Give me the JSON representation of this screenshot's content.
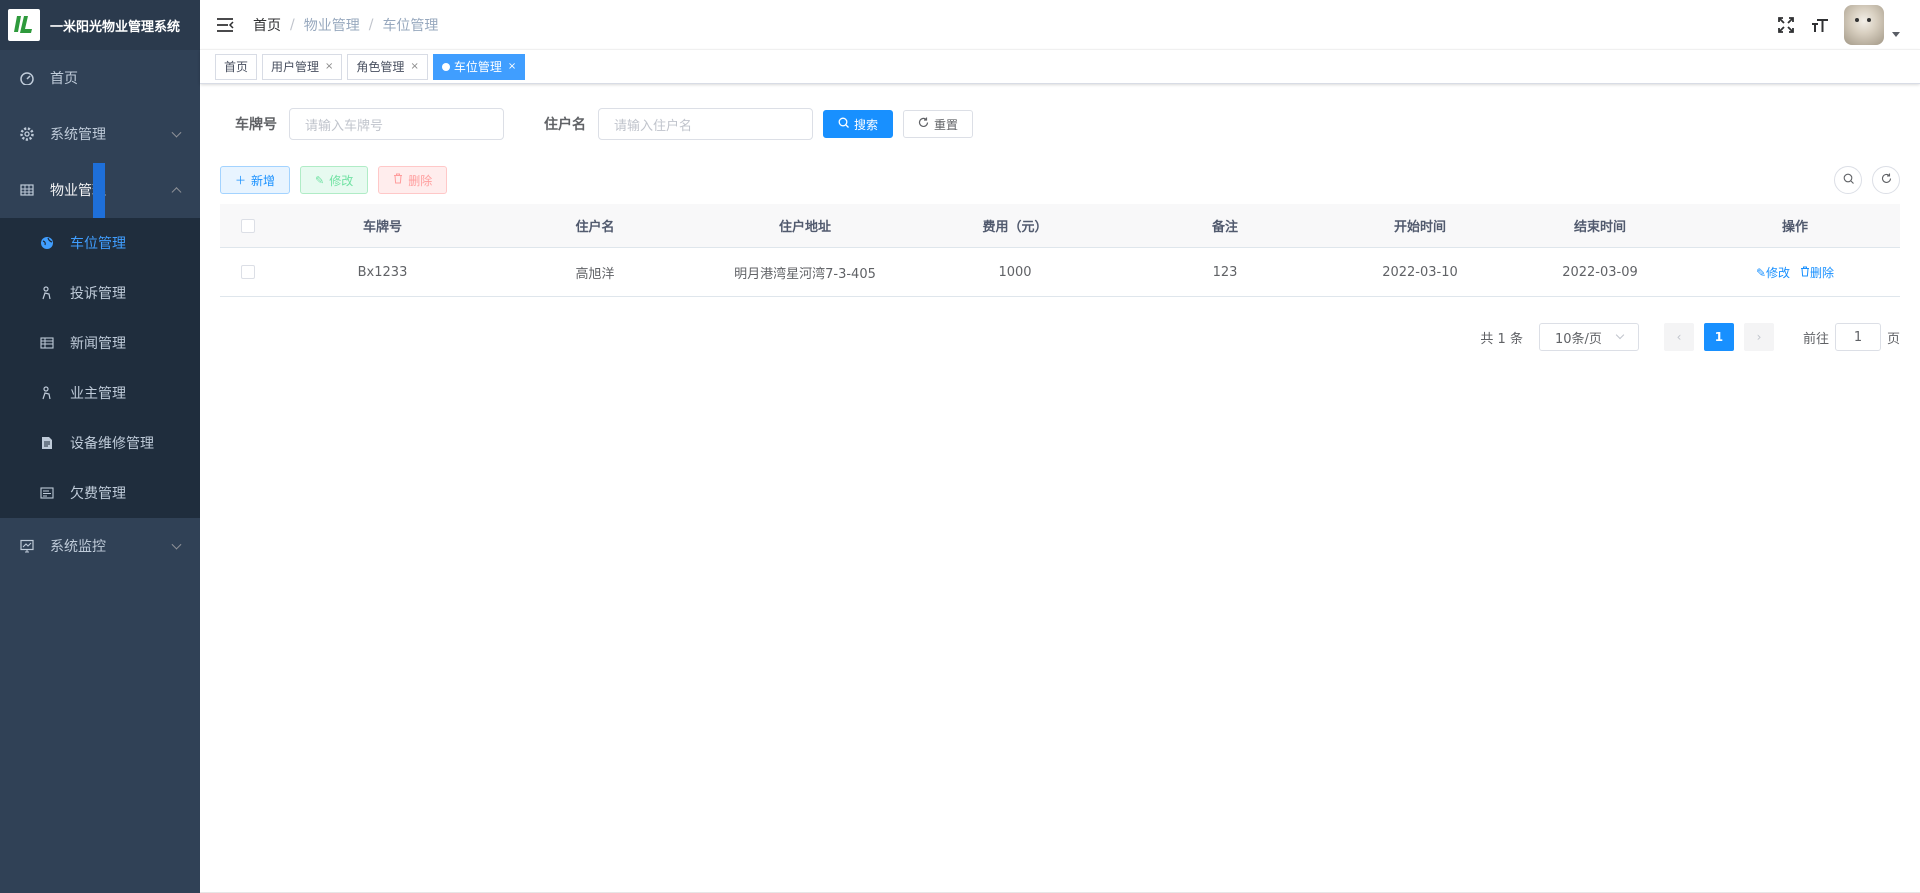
{
  "app": {
    "title": "一米阳光物业管理系统",
    "logo_text": "IL"
  },
  "sidebar": {
    "items": [
      {
        "label": "首页",
        "icon": "dashboard-icon"
      },
      {
        "label": "系统管理",
        "icon": "gear-icon"
      },
      {
        "label": "物业管理",
        "icon": "grid-icon"
      },
      {
        "label": "系统监控",
        "icon": "monitor-icon"
      }
    ],
    "sub_items": [
      {
        "label": "车位管理",
        "icon": "globe-icon",
        "active": true
      },
      {
        "label": "投诉管理",
        "icon": "person-icon"
      },
      {
        "label": "新闻管理",
        "icon": "table-icon"
      },
      {
        "label": "业主管理",
        "icon": "person-icon"
      },
      {
        "label": "设备维修管理",
        "icon": "document-icon"
      },
      {
        "label": "欠费管理",
        "icon": "form-icon"
      }
    ]
  },
  "breadcrumb": [
    "首页",
    "物业管理",
    "车位管理"
  ],
  "tags": [
    {
      "label": "首页"
    },
    {
      "label": "用户管理",
      "close": "×"
    },
    {
      "label": "角色管理",
      "close": "×"
    },
    {
      "label": "车位管理",
      "close": "×",
      "active": true
    }
  ],
  "search": {
    "plate_label": "车牌号",
    "plate_placeholder": "请输入车牌号",
    "resident_label": "住户名",
    "resident_placeholder": "请输入住户名",
    "search_button": "搜索",
    "reset_button": "重置"
  },
  "toolbar": {
    "add": "新增",
    "edit": "修改",
    "delete": "删除"
  },
  "table": {
    "headers": [
      "车牌号",
      "住户名",
      "住户地址",
      "费用（元）",
      "备注",
      "开始时间",
      "结束时间",
      "操作"
    ],
    "rows": [
      {
        "plate": "Bx1233",
        "resident": "高旭洋",
        "address": "明月港湾星河湾7-3-405",
        "fee": "1000",
        "remark": "123",
        "start": "2022-03-10",
        "end": "2022-03-09",
        "edit": "修改",
        "delete": "删除"
      }
    ]
  },
  "pagination": {
    "total": "共 1 条",
    "page_size": "10条/页",
    "current_page": "1",
    "goto_label": "前往",
    "goto_value": "1",
    "page_suffix": "页"
  },
  "colors": {
    "sidebar_bg": "#304156",
    "submenu_bg": "#1f2d3d",
    "accent": "#1890ff",
    "tag_active": "#409eff"
  }
}
